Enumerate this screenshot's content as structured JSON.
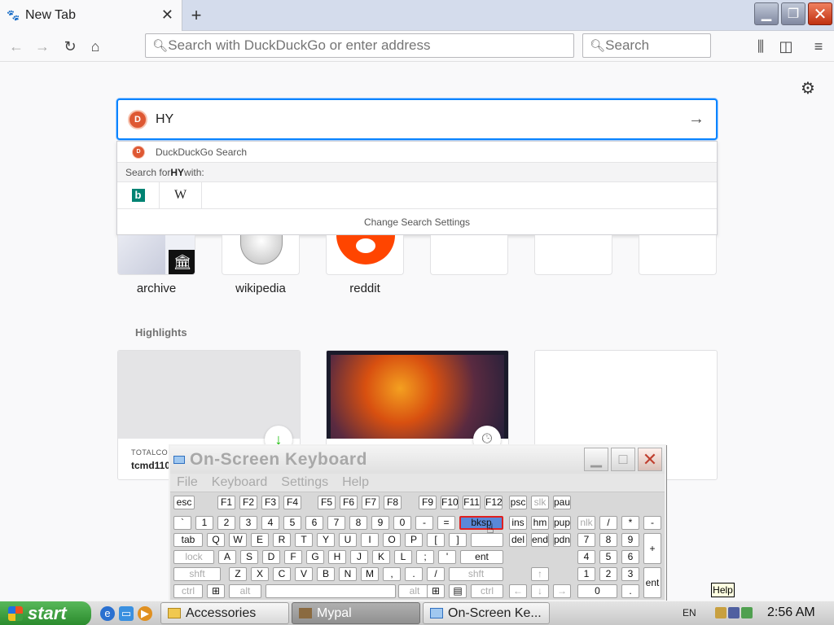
{
  "browser": {
    "tab_title": "New Tab",
    "favicon": "mypal-icon",
    "url_placeholder": "Search with DuckDuckGo or enter address",
    "search_placeholder": "Search"
  },
  "page": {
    "search_value": "HY",
    "suggestions": {
      "engine_label": "DuckDuckGo Search",
      "search_for_prefix": "Search for ",
      "search_for_term": "HY",
      "search_for_suffix": " with:",
      "engines": [
        "bing",
        "wikipedia"
      ],
      "change_settings": "Change Search Settings"
    },
    "top_sites": [
      {
        "label": "archive"
      },
      {
        "label": "wikipedia"
      },
      {
        "label": "reddit"
      },
      {
        "label": ""
      },
      {
        "label": ""
      },
      {
        "label": ""
      }
    ],
    "highlights_title": "Highlights",
    "highlights": [
      {
        "source": "TOTALCO",
        "name": "tcmd110"
      },
      {
        "source": "",
        "name": ""
      },
      {
        "source": "",
        "name": ""
      }
    ]
  },
  "osk": {
    "title": "On-Screen Keyboard",
    "menu": [
      "File",
      "Keyboard",
      "Settings",
      "Help"
    ],
    "highlighted_key": "bksp"
  },
  "tooltip": "Help",
  "taskbar": {
    "start": "start",
    "tasks": [
      "Accessories",
      "Mypal",
      "On-Screen Ke..."
    ],
    "lang": "EN",
    "clock": "2:56 AM"
  }
}
